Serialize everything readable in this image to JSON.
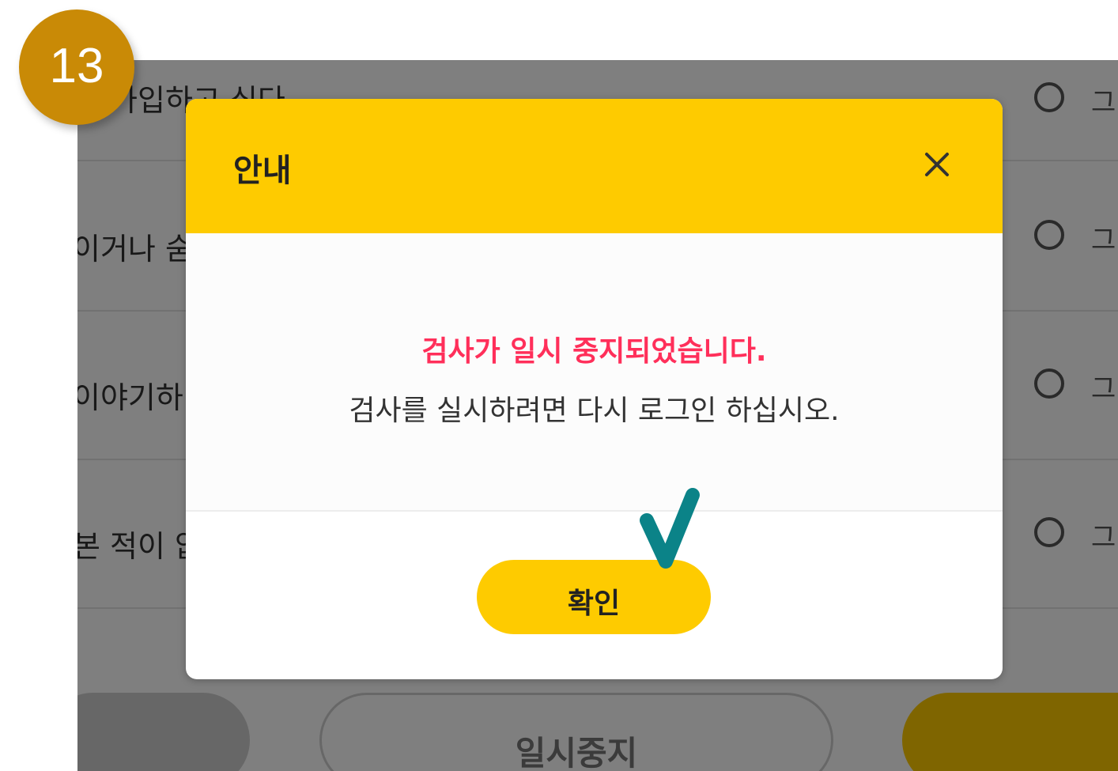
{
  "step_number": "13",
  "background": {
    "questions": [
      {
        "text": "에 가입하고 싶다.",
        "option_label": "그"
      },
      {
        "text": "이거나 숨",
        "option_label": "그"
      },
      {
        "text": "이야기하",
        "option_label": "그"
      },
      {
        "text": "본 적이 없",
        "option_label": "그"
      }
    ],
    "pause_button_label": "일시중지"
  },
  "dialog": {
    "title": "안내",
    "alert_message": "검사가 일시 중지되었습니다.",
    "info_message": "검사를 실시하려면 다시 로그인 하십시오.",
    "confirm_label": "확인"
  },
  "colors": {
    "accent_yellow": "#fecb00",
    "alert_red": "#ff2f5a",
    "badge_gold": "#c98a06",
    "check_teal": "#0b8388"
  }
}
